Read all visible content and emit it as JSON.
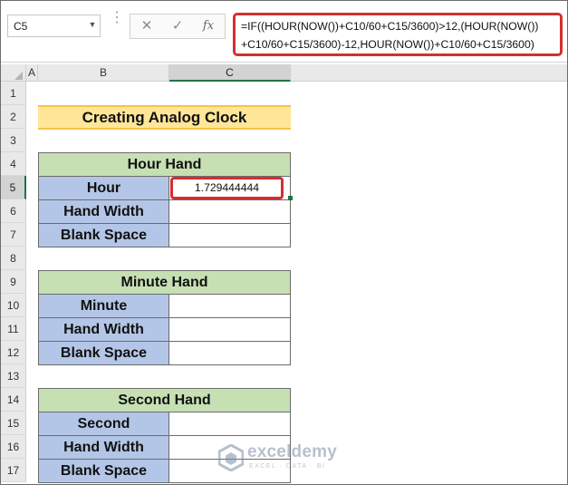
{
  "name_box": {
    "value": "C5",
    "arrow": "▼"
  },
  "formula_bar": {
    "divider": "⋮",
    "cancel_label": "✕",
    "confirm_label": "✓",
    "fx_label": "fx",
    "formula_line1": "=IF((HOUR(NOW())+C10/60+C15/3600)>12,(HOUR(NOW())",
    "formula_line2": "+C10/60+C15/3600)-12,HOUR(NOW())+C10/60+C15/3600)"
  },
  "columns": {
    "a": "A",
    "b": "B",
    "c": "C"
  },
  "rows": [
    "1",
    "2",
    "3",
    "4",
    "5",
    "6",
    "7",
    "8",
    "9",
    "10",
    "11",
    "12",
    "13",
    "14",
    "15",
    "16",
    "17"
  ],
  "sheet": {
    "title": "Creating Analog Clock",
    "hour_hand": {
      "header": "Hour Hand",
      "labels": [
        "Hour",
        "Hand Width",
        "Blank Space"
      ],
      "values": [
        "1.729444444",
        "",
        ""
      ]
    },
    "minute_hand": {
      "header": "Minute Hand",
      "labels": [
        "Minute",
        "Hand Width",
        "Blank Space"
      ],
      "values": [
        "",
        "",
        ""
      ]
    },
    "second_hand": {
      "header": "Second Hand",
      "labels": [
        "Second",
        "Hand Width",
        "Blank Space"
      ],
      "values": [
        "",
        "",
        ""
      ]
    }
  },
  "watermark": {
    "name": "exceldemy",
    "tagline": "EXCEL · DATA · BI",
    "logo_color": "#7d8ea6"
  },
  "colors": {
    "title_fill": "#ffe699",
    "header_fill": "#c6e0b4",
    "label_fill": "#b4c6e7",
    "highlight_red": "#d32f2f",
    "excel_green": "#217346"
  }
}
